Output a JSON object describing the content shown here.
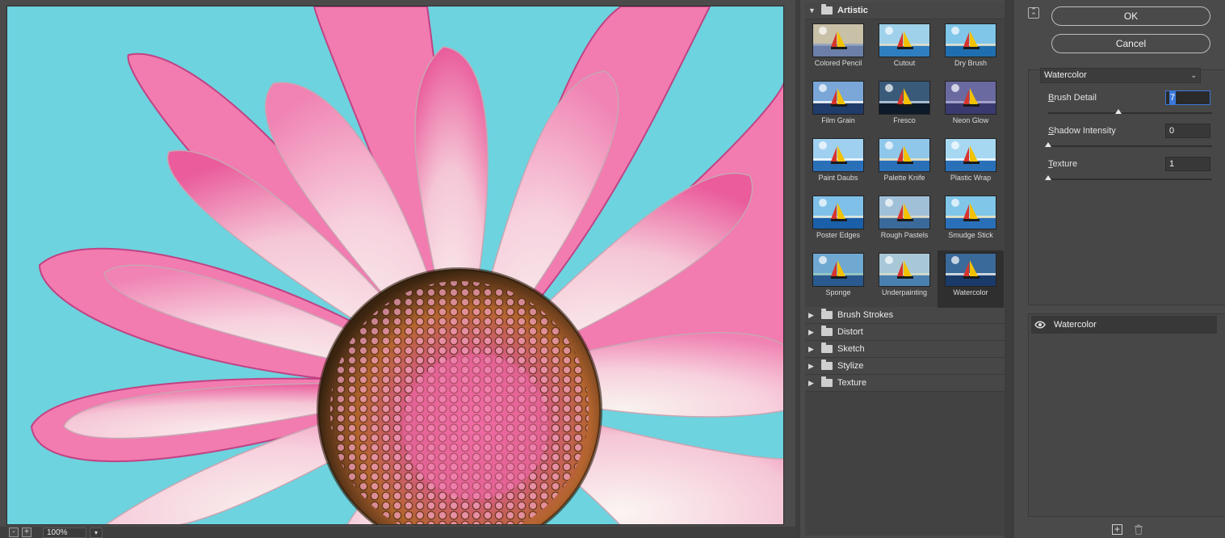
{
  "zoom": {
    "value": "100%",
    "minus_label": "-",
    "plus_label": "+"
  },
  "gallery": {
    "categories": [
      {
        "label": "Artistic",
        "expanded": true
      },
      {
        "label": "Brush Strokes",
        "expanded": false
      },
      {
        "label": "Distort",
        "expanded": false
      },
      {
        "label": "Sketch",
        "expanded": false
      },
      {
        "label": "Stylize",
        "expanded": false
      },
      {
        "label": "Texture",
        "expanded": false
      }
    ],
    "filters": [
      {
        "label": "Colored Pencil"
      },
      {
        "label": "Cutout"
      },
      {
        "label": "Dry Brush"
      },
      {
        "label": "Film Grain"
      },
      {
        "label": "Fresco"
      },
      {
        "label": "Neon Glow"
      },
      {
        "label": "Paint Daubs"
      },
      {
        "label": "Palette Knife"
      },
      {
        "label": "Plastic Wrap"
      },
      {
        "label": "Poster Edges"
      },
      {
        "label": "Rough Pastels"
      },
      {
        "label": "Smudge Stick"
      },
      {
        "label": "Sponge"
      },
      {
        "label": "Underpainting"
      },
      {
        "label": "Watercolor",
        "selected": true
      }
    ]
  },
  "panel": {
    "ok_label": "OK",
    "cancel_label": "Cancel",
    "filter_select": "Watercolor",
    "params": [
      {
        "label_key": "B",
        "label_rest": "rush Detail",
        "value": "7",
        "level": 0.43,
        "active": true
      },
      {
        "label_key": "S",
        "label_rest": "hadow Intensity",
        "value": "0",
        "level": 0.0,
        "active": false
      },
      {
        "label_key": "T",
        "label_rest": "exture",
        "value": "1",
        "level": 0.0,
        "active": false
      }
    ],
    "layer_label": "Watercolor"
  },
  "colors": {
    "accent": "#3b78d8",
    "background": "#4a4a4a",
    "sky": "#62cfdc",
    "petal_pink": "#f06aa5",
    "petal_light": "#f7d3e1"
  }
}
